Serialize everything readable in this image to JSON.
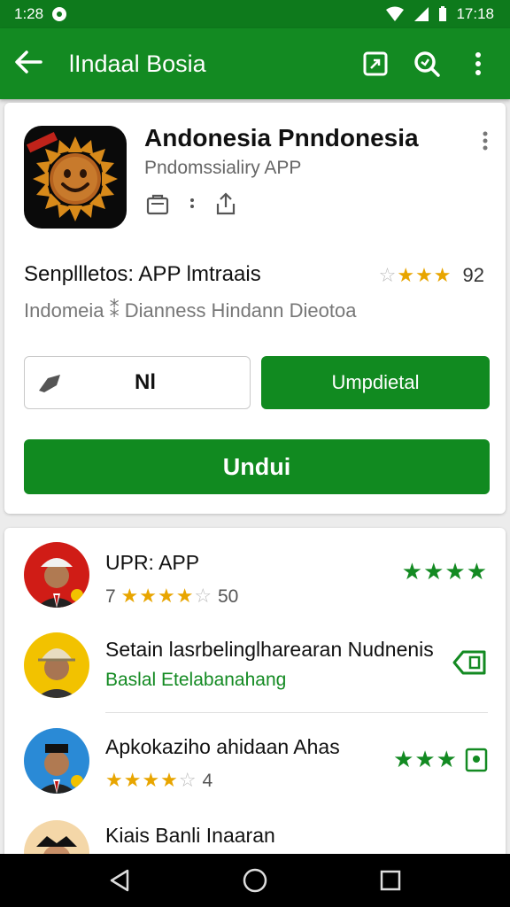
{
  "status_bar": {
    "time": "1:28",
    "right_time": "17:18"
  },
  "app_bar": {
    "title": "lIndaal Bosia"
  },
  "app": {
    "title": "Andonesia Pnndonesia",
    "subtitle": "Pndomssialiry APP",
    "tagline": "Senpllletos: APP lmtraais",
    "rating_value": "92",
    "stars": 4,
    "description": "Indomeia ⁑ Dianness Hindann Dieotoa",
    "secondary_button": "Nl",
    "update_button": "Umpdietal",
    "download_button": "Undui"
  },
  "list": [
    {
      "title": "UPR: APP",
      "sub": "7",
      "rating": "50",
      "stars": 4
    },
    {
      "title": "Setain lasrbelinglharearan Nudnenis",
      "sub": "Baslal Etelabanahang"
    },
    {
      "title": "Apkokaziho ahidaan Ahas",
      "rating": "4",
      "stars": 4
    },
    {
      "title": "Kiais Banli Inaaran"
    }
  ],
  "colors": {
    "brand": "#138a22",
    "status": "#0e7a1c",
    "star": "#e8a500"
  }
}
